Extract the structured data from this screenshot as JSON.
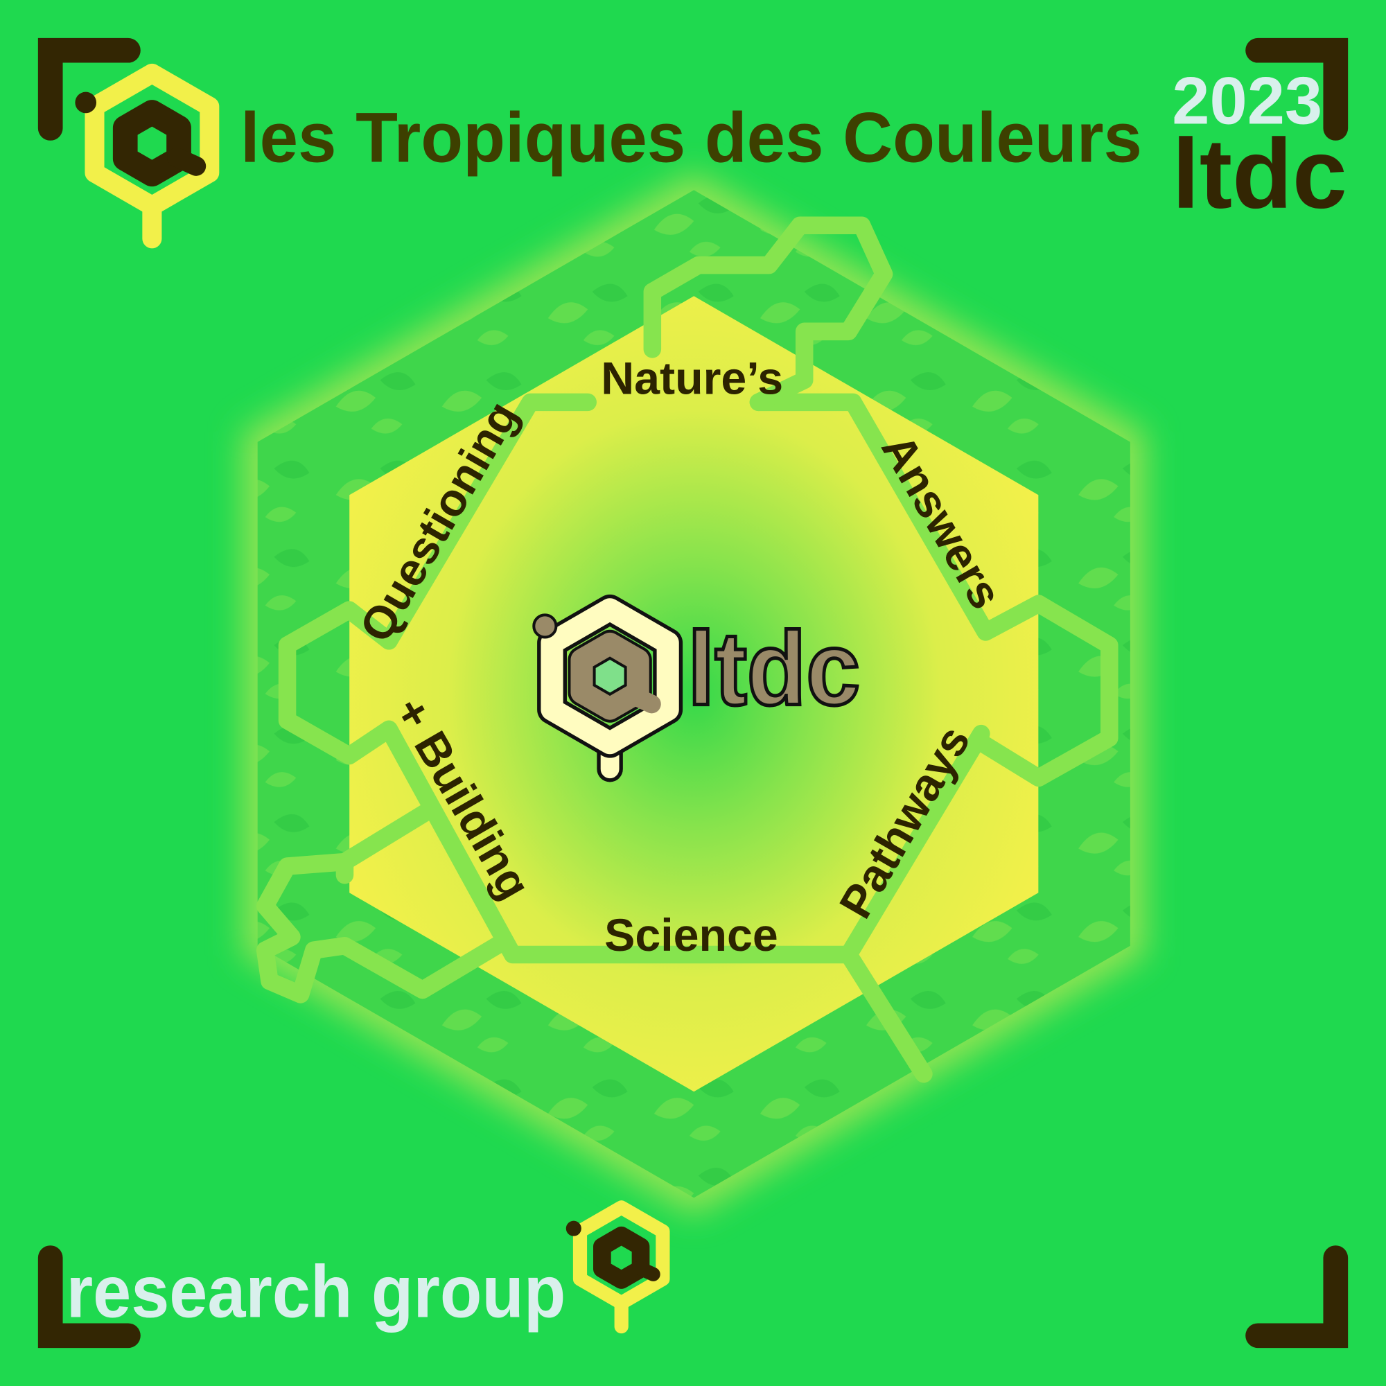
{
  "header": {
    "title": "les Tropiques des Couleurs",
    "year": "2023",
    "brand_short": "ltdc"
  },
  "footer": {
    "label": "research group"
  },
  "center_logo": {
    "text": "ltdc"
  },
  "ring_words": {
    "top": "Nature’s",
    "upper_right": "Answers",
    "lower_right": "Pathways",
    "bottom": "Science",
    "lower_left": "+ Building",
    "upper_left": "Questioning"
  },
  "colors": {
    "background": "#1fd94f",
    "accent_yellow": "#f2f04a",
    "dark": "#332603",
    "title_text": "#3d4000",
    "light_text": "#d9f0ec"
  }
}
